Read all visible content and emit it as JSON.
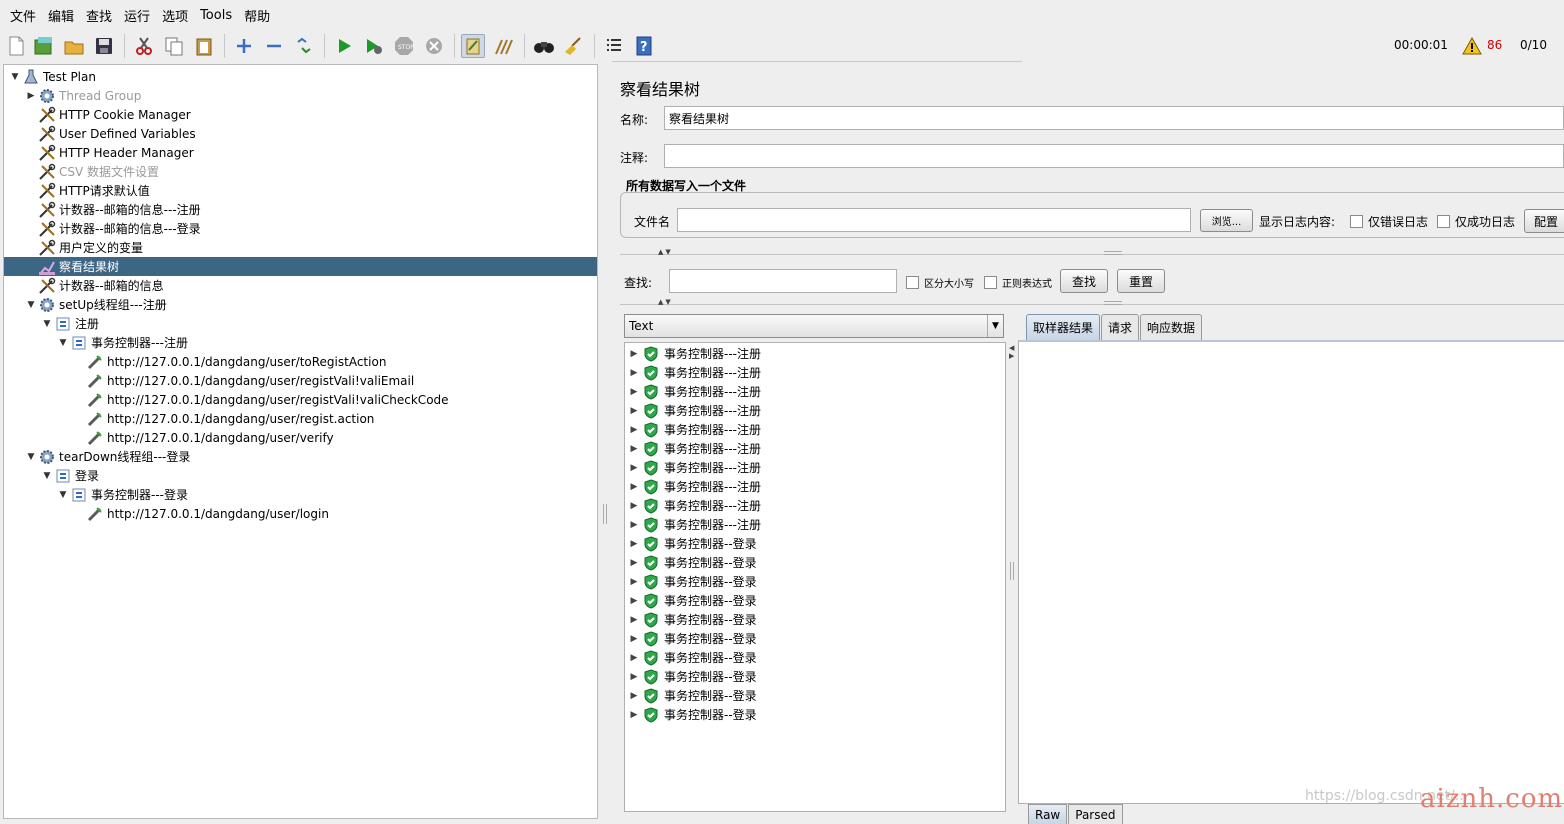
{
  "menu": [
    "文件",
    "编辑",
    "查找",
    "运行",
    "选项",
    "Tools",
    "帮助"
  ],
  "toolbar": {
    "elapsed": "00:00:01",
    "warning_count": "86",
    "threads": "0/10",
    "warning_color": "#cc0000"
  },
  "tree": [
    {
      "label": "Test Plan",
      "icon": "test-plan-icon",
      "expanded": true
    },
    {
      "label": "Thread Group",
      "icon": "gear-icon",
      "collapsed": true,
      "disabled": true
    },
    {
      "label": "HTTP Cookie Manager",
      "icon": "wrench-icon"
    },
    {
      "label": "User Defined Variables",
      "icon": "wrench-icon"
    },
    {
      "label": "HTTP Header Manager",
      "icon": "wrench-icon"
    },
    {
      "label": "CSV 数据文件设置",
      "icon": "wrench-icon",
      "disabled": true
    },
    {
      "label": "HTTP请求默认值",
      "icon": "wrench-icon"
    },
    {
      "label": "计数器--邮箱的信息---注册",
      "icon": "wrench-icon"
    },
    {
      "label": "计数器--邮箱的信息---登录",
      "icon": "wrench-icon"
    },
    {
      "label": "用户定义的变量",
      "icon": "wrench-icon"
    },
    {
      "label": "察看结果树",
      "icon": "listener-icon",
      "selected": true
    },
    {
      "label": "计数器--邮箱的信息",
      "icon": "wrench-icon"
    },
    {
      "label": "setUp线程组---注册",
      "icon": "gear-icon",
      "expanded": true
    },
    {
      "label": "注册",
      "icon": "controller-icon",
      "expanded": true
    },
    {
      "label": "事务控制器---注册",
      "icon": "controller-icon",
      "expanded": true
    },
    {
      "label": "http://127.0.0.1/dangdang/user/toRegistAction",
      "icon": "sampler-icon"
    },
    {
      "label": "http://127.0.0.1/dangdang/user/registVali!valiEmail",
      "icon": "sampler-icon"
    },
    {
      "label": "http://127.0.0.1/dangdang/user/registVali!valiCheckCode",
      "icon": "sampler-icon"
    },
    {
      "label": "http://127.0.0.1/dangdang/user/regist.action",
      "icon": "sampler-icon"
    },
    {
      "label": "http://127.0.0.1/dangdang/user/verify",
      "icon": "sampler-icon"
    },
    {
      "label": "tearDown线程组---登录",
      "icon": "gear-icon",
      "expanded": true
    },
    {
      "label": "登录",
      "icon": "controller-icon",
      "expanded": true
    },
    {
      "label": "事务控制器---登录",
      "icon": "controller-icon",
      "expanded": true
    },
    {
      "label": "http://127.0.0.1/dangdang/user/login",
      "icon": "sampler-icon"
    }
  ],
  "panel": {
    "title": "察看结果树",
    "name_label": "名称:",
    "name_value": "察看结果树",
    "comment_label": "注释:",
    "comment_value": "",
    "file_group_title": "所有数据写入一个文件",
    "filename_label": "文件名",
    "filename_value": "",
    "browse_button": "浏览...",
    "log_display_label": "显示日志内容:",
    "errors_only": "仅错误日志",
    "success_only": "仅成功日志",
    "configure_button": "配置",
    "search_label": "查找:",
    "search_value": "",
    "case_sensitive": "区分大小写",
    "regex": "正则表达式",
    "search_button": "查找",
    "reset_button": "重置",
    "renderer": "Text",
    "tabs": [
      "取样器结果",
      "请求",
      "响应数据"
    ],
    "subtabs": [
      "Raw",
      "Parsed"
    ]
  },
  "results": [
    "事务控制器---注册",
    "事务控制器---注册",
    "事务控制器---注册",
    "事务控制器---注册",
    "事务控制器---注册",
    "事务控制器---注册",
    "事务控制器---注册",
    "事务控制器---注册",
    "事务控制器---注册",
    "事务控制器---注册",
    "事务控制器--登录",
    "事务控制器--登录",
    "事务控制器--登录",
    "事务控制器--登录",
    "事务控制器--登录",
    "事务控制器--登录",
    "事务控制器--登录",
    "事务控制器--登录",
    "事务控制器--登录",
    "事务控制器--登录"
  ],
  "watermark": {
    "text1": "https://blog.csdn.net/...",
    "text2": "aiznh.com"
  }
}
